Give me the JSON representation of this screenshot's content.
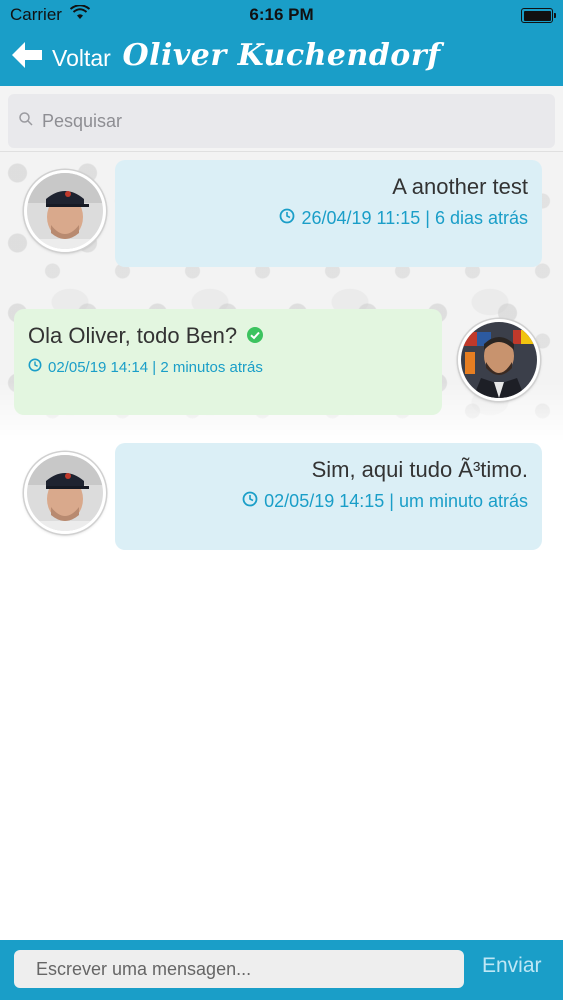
{
  "status_bar": {
    "carrier": "Carrier",
    "time": "6:16 PM"
  },
  "nav": {
    "back_label": "Voltar",
    "title": "Oliver Kuchendorf"
  },
  "search": {
    "placeholder": "Pesquisar"
  },
  "messages": [
    {
      "text": "A another test",
      "meta": "26/04/19 11:15 | 6 dias atrás",
      "direction": "incoming"
    },
    {
      "text": "Ola Oliver, todo Ben?",
      "meta": "02/05/19 14:14 | 2 minutos atrás",
      "direction": "outgoing",
      "status": "read"
    },
    {
      "text": "Sim, aqui tudo Ã³timo.",
      "meta": "02/05/19 14:15 | um minuto atrás",
      "direction": "incoming"
    }
  ],
  "composer": {
    "placeholder": "Escrever uma mensagen...",
    "send_label": "Enviar"
  },
  "colors": {
    "primary": "#1a9ec8",
    "incoming_bubble": "#dbeff6",
    "outgoing_bubble": "#e3f6e0",
    "check": "#3cc35f"
  }
}
